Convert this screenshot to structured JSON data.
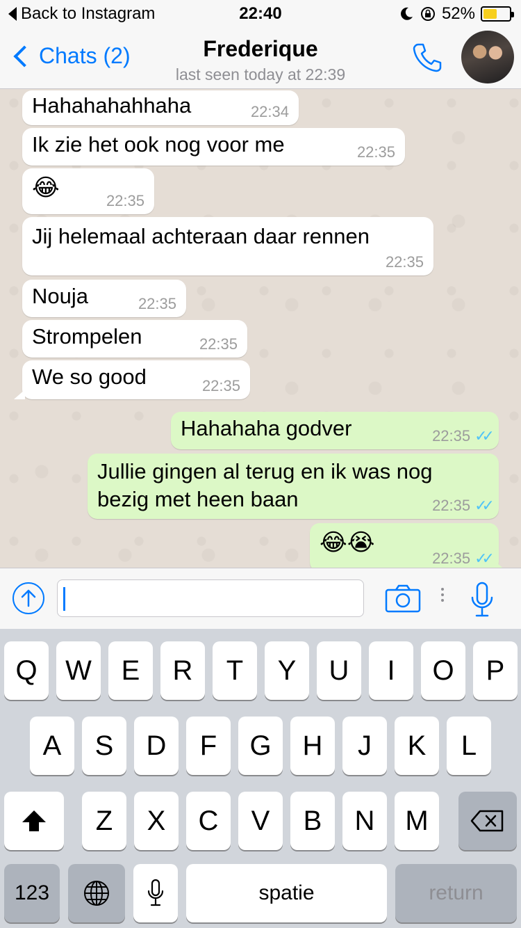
{
  "status_bar": {
    "back_label": "Back to Instagram",
    "time": "22:40",
    "battery": "52%",
    "battery_level": 0.52
  },
  "nav": {
    "back_label": "Chats (2)",
    "title": "Frederique",
    "subtitle": "last seen today at 22:39"
  },
  "messages": [
    {
      "dir": "in",
      "text": "Hahahahahhaha",
      "time": "22:34"
    },
    {
      "dir": "in",
      "text": "Ik zie het ook nog voor me",
      "time": "22:35"
    },
    {
      "dir": "in",
      "text": "😂",
      "time": "22:35"
    },
    {
      "dir": "in",
      "text": "Jij helemaal achteraan daar rennen",
      "time": "22:35"
    },
    {
      "dir": "in",
      "text": "Nouja",
      "time": "22:35"
    },
    {
      "dir": "in",
      "text": "Strompelen",
      "time": "22:35"
    },
    {
      "dir": "in",
      "text": "We so good",
      "time": "22:35"
    },
    {
      "dir": "out",
      "text": "Hahahaha godver",
      "time": "22:35",
      "read": true
    },
    {
      "dir": "out",
      "text": "Jullie gingen al terug en ik was nog\nbezig met heen baan",
      "time": "22:35",
      "read": true
    },
    {
      "dir": "out",
      "text": "😂😭",
      "time": "22:35",
      "read": true
    }
  ],
  "input": {
    "value": "",
    "placeholder": ""
  },
  "keyboard": {
    "row1": [
      "Q",
      "W",
      "E",
      "R",
      "T",
      "Y",
      "U",
      "I",
      "O",
      "P"
    ],
    "row2": [
      "A",
      "S",
      "D",
      "F",
      "G",
      "H",
      "J",
      "K",
      "L"
    ],
    "row3": [
      "Z",
      "X",
      "C",
      "V",
      "B",
      "N",
      "M"
    ],
    "numbers_label": "123",
    "space_label": "spatie",
    "return_label": "return"
  },
  "icons": [
    "back-caret-icon",
    "moon-icon",
    "rotation-lock-icon",
    "battery-icon",
    "chevron-left-icon",
    "phone-icon",
    "avatar",
    "arrow-up-icon",
    "camera-icon",
    "microphone-icon",
    "shift-icon",
    "delete-icon",
    "globe-icon",
    "dictation-icon"
  ],
  "colors": {
    "accent": "#007aff",
    "outgoing_bubble": "#dcf8c6",
    "incoming_bubble": "#ffffff",
    "chat_background": "#e5ddd5",
    "read_ticks": "#4fc3f7",
    "battery_fill": "#f7cf1d"
  }
}
